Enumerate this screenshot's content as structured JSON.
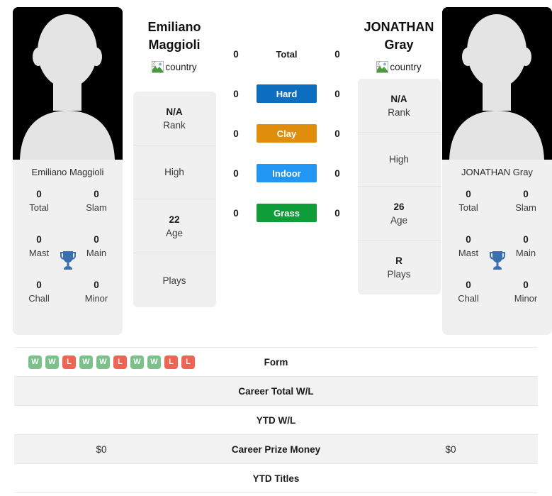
{
  "players": {
    "left": {
      "name": "Emiliano Maggioli",
      "name_line1": "Emiliano",
      "name_line2": "Maggioli",
      "country_alt": "country",
      "country_icon": "broken-image-icon",
      "avatar_icon": "player-silhouette-avatar",
      "trophies": {
        "total": {
          "value": "0",
          "label": "Total"
        },
        "slam": {
          "value": "0",
          "label": "Slam"
        },
        "mast": {
          "value": "0",
          "label": "Mast"
        },
        "main": {
          "value": "0",
          "label": "Main"
        },
        "chall": {
          "value": "0",
          "label": "Chall"
        },
        "minor": {
          "value": "0",
          "label": "Minor"
        },
        "trophy_icon": "trophy-icon"
      },
      "info": [
        {
          "value": "N/A",
          "caption": "Rank"
        },
        {
          "value": "",
          "caption": "High"
        },
        {
          "value": "22",
          "caption": "Age"
        },
        {
          "value": "",
          "caption": "Plays"
        }
      ]
    },
    "right": {
      "name": "JONATHAN Gray",
      "name_line1": "JONATHAN",
      "name_line2": "Gray",
      "country_alt": "country",
      "country_icon": "broken-image-icon",
      "avatar_icon": "player-silhouette-avatar",
      "trophies": {
        "total": {
          "value": "0",
          "label": "Total"
        },
        "slam": {
          "value": "0",
          "label": "Slam"
        },
        "mast": {
          "value": "0",
          "label": "Mast"
        },
        "main": {
          "value": "0",
          "label": "Main"
        },
        "chall": {
          "value": "0",
          "label": "Chall"
        },
        "minor": {
          "value": "0",
          "label": "Minor"
        },
        "trophy_icon": "trophy-icon"
      },
      "info": [
        {
          "value": "N/A",
          "caption": "Rank"
        },
        {
          "value": "",
          "caption": "High"
        },
        {
          "value": "26",
          "caption": "Age"
        },
        {
          "value": "R",
          "caption": "Plays"
        }
      ]
    }
  },
  "surfaces": [
    {
      "label": "Total",
      "left": "0",
      "right": "0",
      "color": "transparent",
      "bar": false
    },
    {
      "label": "Hard",
      "left": "0",
      "right": "0",
      "color": "#0d6ec0",
      "bar": true
    },
    {
      "label": "Clay",
      "left": "0",
      "right": "0",
      "color": "#e08e0b",
      "bar": true
    },
    {
      "label": "Indoor",
      "left": "0",
      "right": "0",
      "color": "#2196f3",
      "bar": true
    },
    {
      "label": "Grass",
      "left": "0",
      "right": "0",
      "color": "#0f9d3a",
      "bar": true
    }
  ],
  "stats_rows": [
    {
      "label": "Form",
      "left": "",
      "right": "",
      "form": [
        "W",
        "W",
        "L",
        "W",
        "W",
        "L",
        "W",
        "W",
        "L",
        "L"
      ]
    },
    {
      "label": "Career Total W/L",
      "left": "",
      "right": ""
    },
    {
      "label": "YTD W/L",
      "left": "",
      "right": ""
    },
    {
      "label": "Career Prize Money",
      "left": "$0",
      "right": "$0"
    },
    {
      "label": "YTD Titles",
      "left": "",
      "right": ""
    }
  ],
  "colors": {
    "hard": "#0d6ec0",
    "clay": "#e08e0b",
    "indoor": "#2196f3",
    "grass": "#0f9d3a",
    "win_badge": "#7cc08a",
    "loss_badge": "#ee6352",
    "trophy": "#3b6fb0",
    "card_bg": "#f0f0f0"
  }
}
